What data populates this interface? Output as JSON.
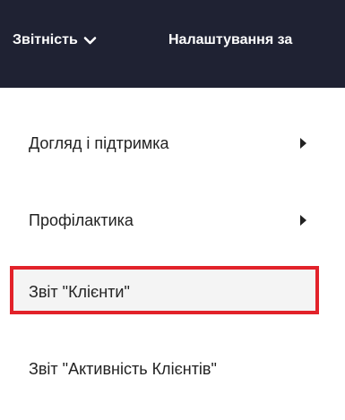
{
  "topbar": {
    "reports_label": "Звітність",
    "settings_label": "Налаштування за",
    "chevron_icon": "chevron-down-icon"
  },
  "menu": {
    "items": [
      {
        "label": "Догляд і підтримка",
        "has_submenu": true
      },
      {
        "label": "Профілактика",
        "has_submenu": true
      },
      {
        "label": "Звіт \"Клієнти\"",
        "has_submenu": false,
        "highlighted": true
      },
      {
        "label": "Звіт \"Активність Клієнтів\"",
        "has_submenu": false
      }
    ]
  },
  "colors": {
    "topbar_bg": "#1f2233",
    "highlight_border": "#e2222a"
  }
}
